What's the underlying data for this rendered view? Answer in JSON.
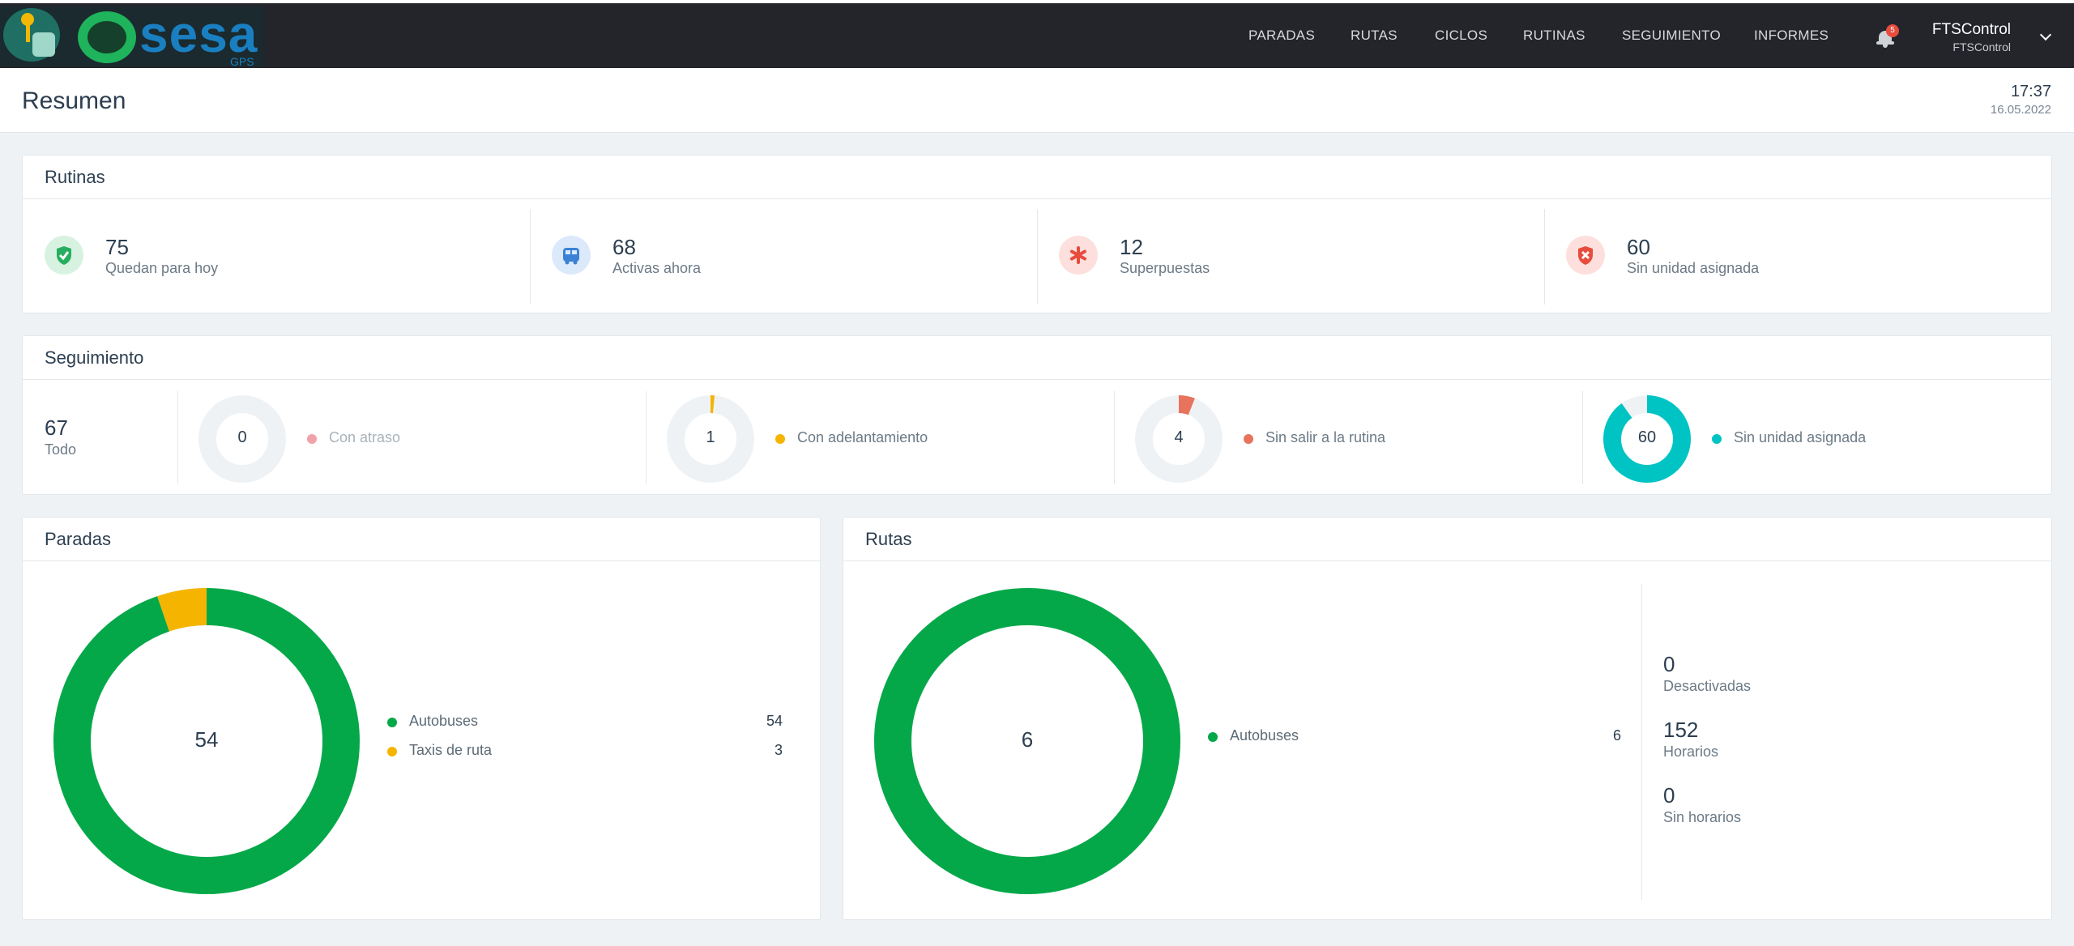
{
  "brand": {
    "wordmark": "sesa",
    "sub": "GPS"
  },
  "nav": {
    "items": [
      "PARADAS",
      "RUTAS",
      "CICLOS",
      "RUTINAS",
      "SEGUIMIENTO",
      "INFORMES"
    ]
  },
  "notifications": {
    "count": "5"
  },
  "user": {
    "name": "FTSControl",
    "account": "FTSControl"
  },
  "header": {
    "title": "Resumen",
    "time": "17:37",
    "date": "16.05.2022"
  },
  "rutinas": {
    "title": "Rutinas",
    "stats": [
      {
        "value": "75",
        "label": "Quedan para hoy",
        "icon": "shield-check-icon",
        "color": "#27ae60"
      },
      {
        "value": "68",
        "label": "Activas ahora",
        "icon": "bus-icon",
        "color": "#3b82d6"
      },
      {
        "value": "12",
        "label": "Superpuestas",
        "icon": "asterisk-icon",
        "color": "#e74c3c"
      },
      {
        "value": "60",
        "label": "Sin unidad asignada",
        "icon": "shield-x-icon",
        "color": "#e74c3c"
      }
    ]
  },
  "seguimiento": {
    "title": "Seguimiento",
    "total": {
      "value": "67",
      "label": "Todo"
    },
    "gauges": [
      {
        "value": "0",
        "label": "Con atraso",
        "color": "#f1a1a8",
        "fraction": 0
      },
      {
        "value": "1",
        "label": "Con adelantamiento",
        "color": "#f5b400",
        "fraction": 0.015
      },
      {
        "value": "4",
        "label": "Sin salir a la rutina",
        "color": "#e8735d",
        "fraction": 0.06
      },
      {
        "value": "60",
        "label": "Sin unidad asignada",
        "color": "#00c4c4",
        "fraction": 0.9
      }
    ]
  },
  "paradas": {
    "title": "Paradas",
    "total": "54"
  },
  "rutas": {
    "title": "Rutas",
    "total": "6",
    "stats": [
      {
        "value": "0",
        "label": "Desactivadas"
      },
      {
        "value": "152",
        "label": "Horarios"
      },
      {
        "value": "0",
        "label": "Sin horarios"
      }
    ]
  },
  "chart_data": [
    {
      "type": "pie",
      "title": "Paradas",
      "center_label": "54",
      "categories": [
        "Autobuses",
        "Taxis de ruta"
      ],
      "values": [
        54,
        3
      ],
      "colors": [
        "#05a849",
        "#f5b400"
      ]
    },
    {
      "type": "pie",
      "title": "Rutas",
      "center_label": "6",
      "categories": [
        "Autobuses"
      ],
      "values": [
        6
      ],
      "colors": [
        "#05a849"
      ]
    }
  ]
}
